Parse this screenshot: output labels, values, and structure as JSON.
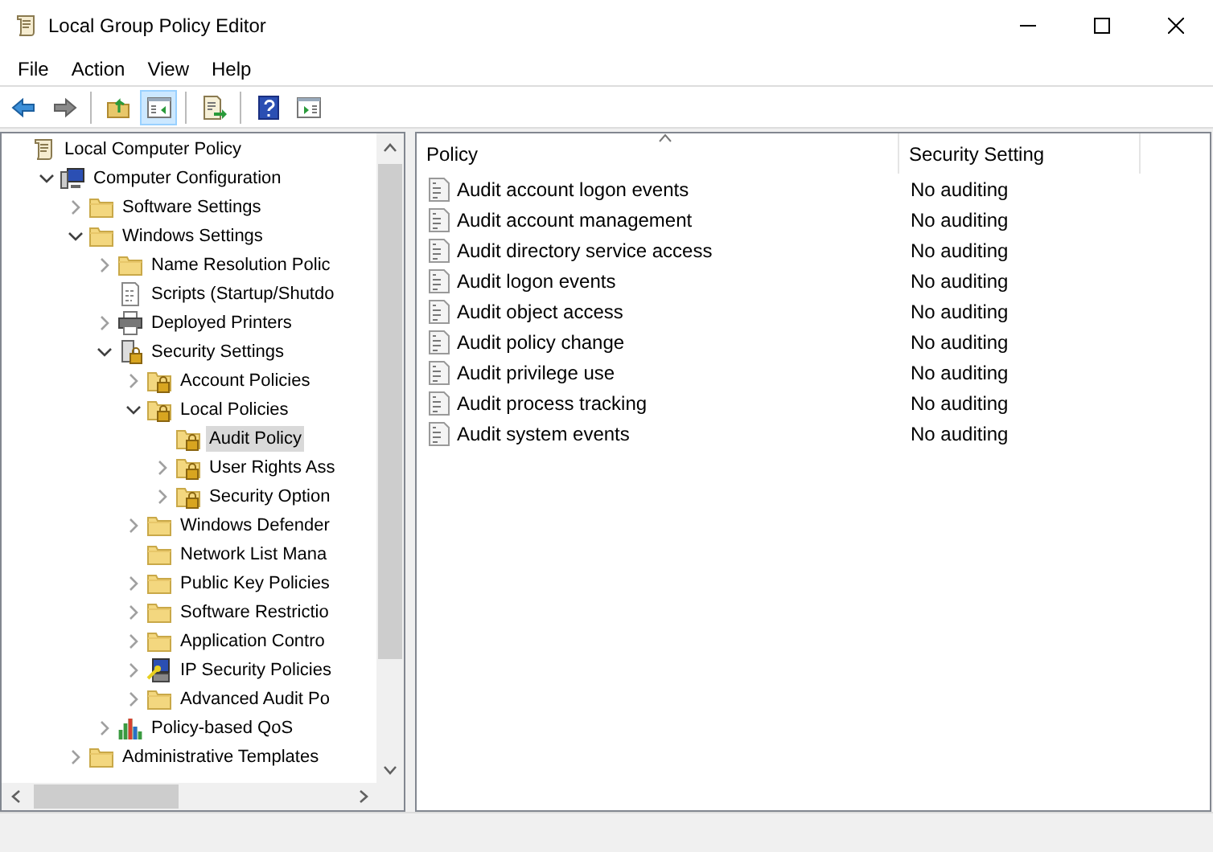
{
  "window": {
    "title": "Local Group Policy Editor"
  },
  "menu": [
    "File",
    "Action",
    "View",
    "Help"
  ],
  "toolbar": [
    {
      "kind": "back",
      "selected": false
    },
    {
      "kind": "forward",
      "selected": false
    },
    {
      "kind": "sep"
    },
    {
      "kind": "up",
      "selected": false
    },
    {
      "kind": "tree",
      "selected": true
    },
    {
      "kind": "sep"
    },
    {
      "kind": "export",
      "selected": false
    },
    {
      "kind": "sep"
    },
    {
      "kind": "help",
      "selected": false
    },
    {
      "kind": "pane",
      "selected": false
    }
  ],
  "tree": [
    {
      "label": "Local Computer Policy",
      "kind": "policy",
      "selected": false,
      "children": [
        {
          "label": "Computer Configuration",
          "kind": "computer",
          "expanded": true,
          "selected": false,
          "children": [
            {
              "label": "Software Settings",
              "kind": "folder",
              "expanded": false,
              "selected": false
            },
            {
              "label": "Windows Settings",
              "kind": "folder",
              "expanded": true,
              "selected": false,
              "children": [
                {
                  "label": "Name Resolution Polic",
                  "kind": "folder",
                  "expanded": false,
                  "selected": false
                },
                {
                  "label": "Scripts (Startup/Shutdo",
                  "kind": "script",
                  "selected": false
                },
                {
                  "label": "Deployed Printers",
                  "kind": "printer",
                  "expanded": false,
                  "selected": false
                },
                {
                  "label": "Security Settings",
                  "kind": "secure",
                  "expanded": true,
                  "selected": false,
                  "children": [
                    {
                      "label": "Account Policies",
                      "kind": "lockfolder",
                      "expanded": false,
                      "selected": false
                    },
                    {
                      "label": "Local Policies",
                      "kind": "lockfolder",
                      "expanded": true,
                      "selected": false,
                      "children": [
                        {
                          "label": "Audit Policy",
                          "kind": "lockfolder",
                          "selected": true
                        },
                        {
                          "label": "User Rights Ass",
                          "kind": "lockfolder",
                          "expanded": false,
                          "selected": false
                        },
                        {
                          "label": "Security Option",
                          "kind": "lockfolder",
                          "expanded": false,
                          "selected": false
                        }
                      ]
                    },
                    {
                      "label": "Windows Defender",
                      "kind": "folder",
                      "expanded": false,
                      "selected": false
                    },
                    {
                      "label": "Network List Mana",
                      "kind": "folder",
                      "selected": false
                    },
                    {
                      "label": "Public Key Policies",
                      "kind": "folder",
                      "expanded": false,
                      "selected": false
                    },
                    {
                      "label": "Software Restrictio",
                      "kind": "folder",
                      "expanded": false,
                      "selected": false
                    },
                    {
                      "label": "Application Contro",
                      "kind": "folder",
                      "expanded": false,
                      "selected": false
                    },
                    {
                      "label": "IP Security Policies",
                      "kind": "ipsec",
                      "expanded": false,
                      "selected": false
                    },
                    {
                      "label": "Advanced Audit Po",
                      "kind": "folder",
                      "expanded": false,
                      "selected": false
                    }
                  ]
                },
                {
                  "label": "Policy-based QoS",
                  "kind": "qos",
                  "expanded": false,
                  "selected": false
                }
              ]
            },
            {
              "label": "Administrative Templates",
              "kind": "folder",
              "expanded": false,
              "selected": false
            }
          ]
        }
      ]
    }
  ],
  "table": {
    "columns": [
      "Policy",
      "Security Setting"
    ],
    "rows": [
      [
        "Audit account logon events",
        "No auditing"
      ],
      [
        "Audit account management",
        "No auditing"
      ],
      [
        "Audit directory service access",
        "No auditing"
      ],
      [
        "Audit logon events",
        "No auditing"
      ],
      [
        "Audit object access",
        "No auditing"
      ],
      [
        "Audit policy change",
        "No auditing"
      ],
      [
        "Audit privilege use",
        "No auditing"
      ],
      [
        "Audit process tracking",
        "No auditing"
      ],
      [
        "Audit system events",
        "No auditing"
      ]
    ]
  }
}
